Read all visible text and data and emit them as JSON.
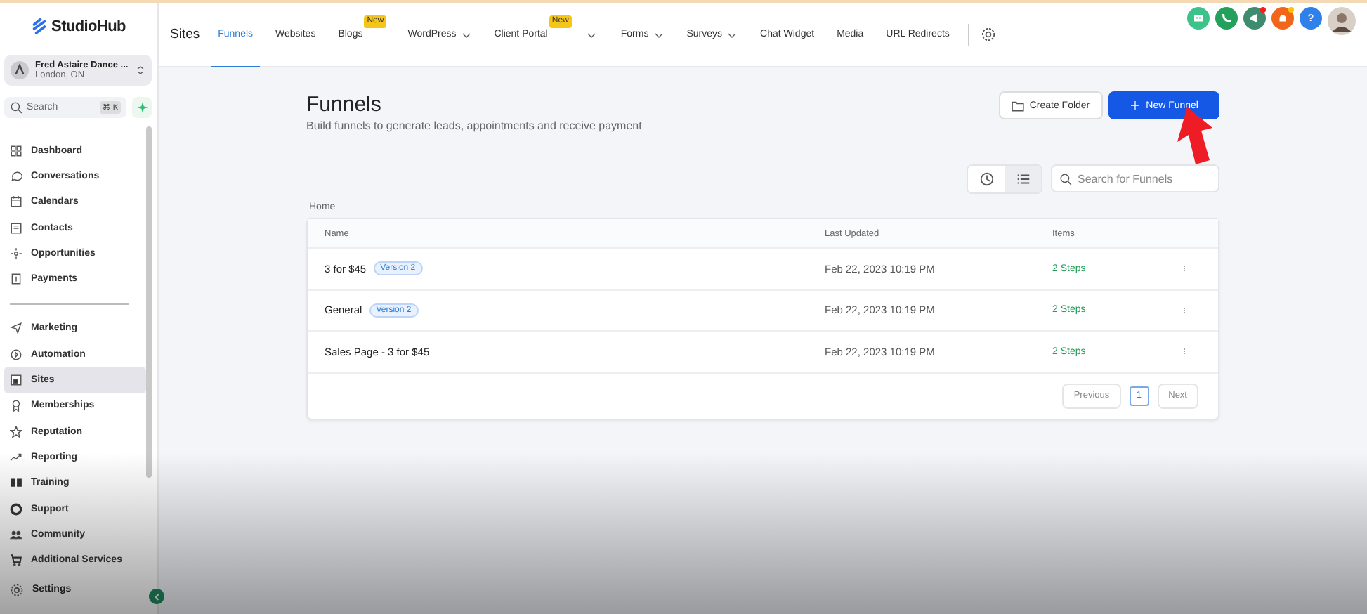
{
  "brand": {
    "name": "StudioHub"
  },
  "account": {
    "name": "Fred Astaire Dance ...",
    "location": "London, ON"
  },
  "sidebar_search": {
    "placeholder": "Search",
    "shortcut": "⌘ K"
  },
  "sidebar": {
    "groups": [
      [
        {
          "label": "Dashboard",
          "selected": false
        },
        {
          "label": "Conversations",
          "selected": false
        },
        {
          "label": "Calendars",
          "selected": false
        },
        {
          "label": "Contacts",
          "selected": false
        },
        {
          "label": "Opportunities",
          "selected": false
        },
        {
          "label": "Payments",
          "selected": false
        }
      ],
      [
        {
          "label": "Marketing",
          "selected": false
        },
        {
          "label": "Automation",
          "selected": false
        },
        {
          "label": "Sites",
          "selected": true
        },
        {
          "label": "Memberships",
          "selected": false
        },
        {
          "label": "Reputation",
          "selected": false
        },
        {
          "label": "Reporting",
          "selected": false
        },
        {
          "label": "Training",
          "selected": false
        },
        {
          "label": "Support",
          "selected": false
        },
        {
          "label": "Community",
          "selected": false
        },
        {
          "label": "Additional Services",
          "selected": false
        }
      ]
    ],
    "settings": "Settings"
  },
  "topnav": {
    "section": "Sites",
    "tabs": [
      {
        "label": "Funnels",
        "selected": true,
        "dropdown": false
      },
      {
        "label": "Websites",
        "selected": false,
        "dropdown": false
      },
      {
        "label": "Blogs",
        "selected": false,
        "dropdown": false,
        "badge": "New"
      },
      {
        "label": "WordPress",
        "selected": false,
        "dropdown": true
      },
      {
        "label": "Client Portal",
        "selected": false,
        "dropdown": true,
        "badge": "New"
      },
      {
        "label": "Forms",
        "selected": false,
        "dropdown": true
      },
      {
        "label": "Surveys",
        "selected": false,
        "dropdown": true
      },
      {
        "label": "Chat Widget",
        "selected": false,
        "dropdown": false
      },
      {
        "label": "Media",
        "selected": false,
        "dropdown": false
      },
      {
        "label": "URL Redirects",
        "selected": false,
        "dropdown": false
      }
    ]
  },
  "header_buttons": [
    {
      "kind": "robot",
      "color": "#3cc38a",
      "notification": false
    },
    {
      "kind": "phone",
      "color": "#22a05c",
      "notification": false
    },
    {
      "kind": "megaphone",
      "color": "#3d8c70",
      "notification": true
    },
    {
      "kind": "bell",
      "color": "#f2661c",
      "notification": true
    },
    {
      "kind": "help",
      "color": "#2f80e8",
      "notification": false,
      "text": "?"
    }
  ],
  "page": {
    "title": "Funnels",
    "subtitle": "Build funnels to generate leads, appointments and receive payment",
    "create_button": "Create Folder",
    "new_button": "New Funnel",
    "views": [
      {
        "kind": "clock",
        "selected": false
      },
      {
        "kind": "list",
        "selected": true
      }
    ],
    "search": {
      "placeholder": "Search for Funnels"
    },
    "breadcrumb": "Home"
  },
  "table": {
    "columns": [
      "Name",
      "Last Updated",
      "Items"
    ],
    "rows": [
      {
        "name": "3 for $45",
        "tag": "Version 2",
        "updated": "Feb 22, 2023 10:19 PM",
        "items": "2 Steps"
      },
      {
        "name": "General",
        "tag": "Version 2",
        "updated": "Feb 22, 2023 10:19 PM",
        "items": "2 Steps"
      },
      {
        "name": "Sales Page - 3 for $45",
        "updated": "Feb 22, 2023 10:19 PM",
        "items": "2 Steps"
      }
    ]
  },
  "pagination": {
    "previous": "Previous",
    "pages": [
      {
        "label": "1",
        "selected": true
      }
    ],
    "next": "Next"
  }
}
